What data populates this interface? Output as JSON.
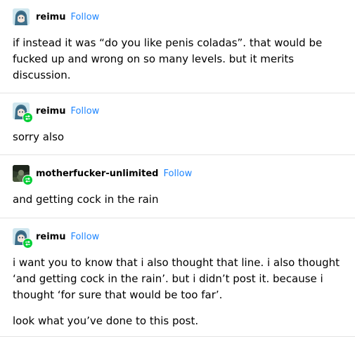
{
  "posts": [
    {
      "username": "reimu",
      "follow_label": "Follow",
      "reblog": false,
      "avatar": "anime-avatar-teal",
      "paragraphs": [
        "if instead it was “do you like penis coladas”. that would be fucked up and wrong on so many levels. but it merits discussion."
      ]
    },
    {
      "username": "reimu",
      "follow_label": "Follow",
      "reblog": true,
      "avatar": "anime-avatar-teal",
      "paragraphs": [
        "sorry also"
      ]
    },
    {
      "username": "motherfucker-unlimited",
      "follow_label": "Follow",
      "reblog": true,
      "avatar": "dark-photo-avatar",
      "paragraphs": [
        "and getting cock in the rain"
      ]
    },
    {
      "username": "reimu",
      "follow_label": "Follow",
      "reblog": true,
      "avatar": "anime-avatar-teal",
      "paragraphs": [
        "i want you to know that i also thought that line. i also thought ‘and getting cock in the rain’. but i didn’t post it. because i thought ‘for sure that would be too far’.",
        "look what you’ve done to this post."
      ]
    }
  ],
  "colors": {
    "follow": "#1f86ff",
    "reblog_badge": "#00cf35",
    "divider": "#e3e3e3"
  },
  "icons": {
    "reblog_badge": "reblog-arrows-icon"
  }
}
